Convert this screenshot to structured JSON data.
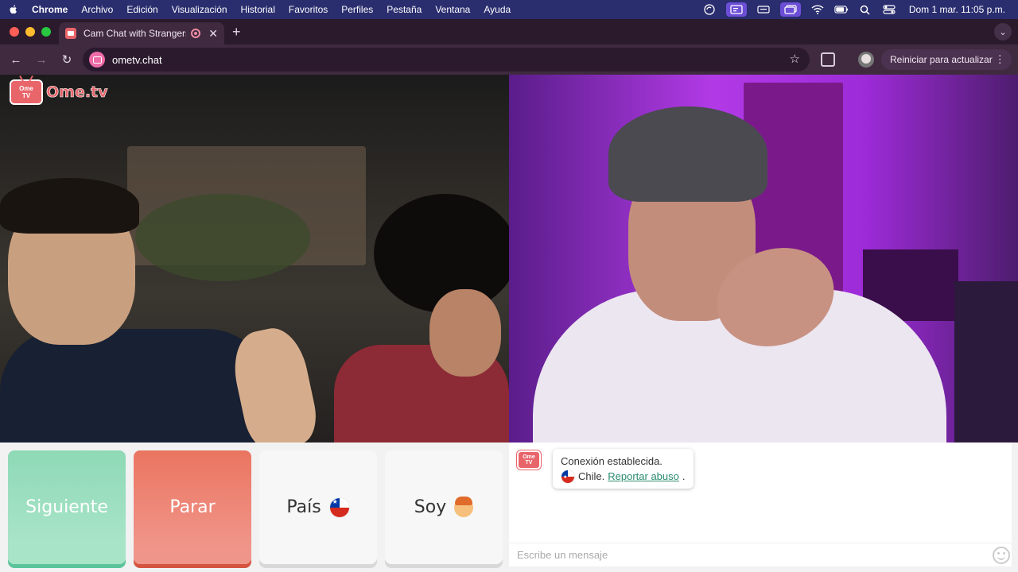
{
  "menubar": {
    "app": "Chrome",
    "items": [
      "Archivo",
      "Edición",
      "Visualización",
      "Historial",
      "Favoritos",
      "Perfiles",
      "Pestaña",
      "Ventana",
      "Ayuda"
    ],
    "clock": "Dom 1 mar.  11:05 p.m."
  },
  "browser": {
    "tab_title": "Cam Chat with Strangers",
    "url": "ometv.chat",
    "update_label": "Reiniciar para actualizar"
  },
  "logo": {
    "badge_line1": "Ome",
    "badge_line2": "TV",
    "word": "Ome.tv"
  },
  "controls": {
    "next_label": "Siguiente",
    "stop_label": "Parar",
    "country_label": "País",
    "gender_label": "Soy"
  },
  "chat": {
    "status": "Conexión establecida.",
    "country": "Chile.",
    "report_link": "Reportar abuso",
    "period": ".",
    "placeholder": "Escribe un mensaje"
  },
  "colors": {
    "next": "#8ed9b6",
    "stop": "#ea7560",
    "brand": "#e8656a",
    "link": "#2a8a6e"
  }
}
